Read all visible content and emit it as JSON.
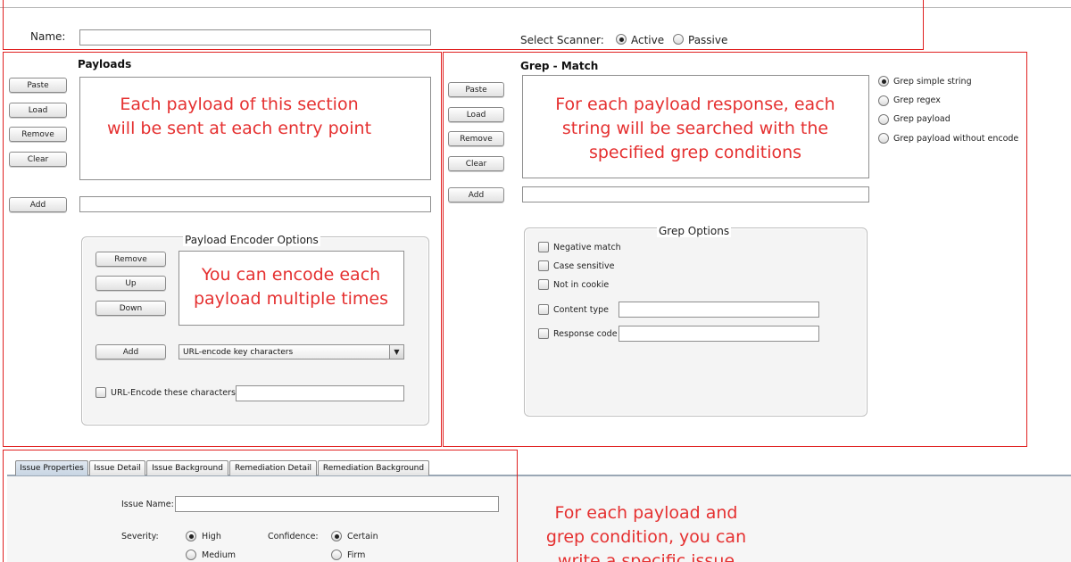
{
  "top": {
    "name_label": "Name:",
    "name_value": "",
    "scanner_label": "Select Scanner:",
    "scanner_options": [
      "Active",
      "Passive"
    ],
    "scanner_selected": "Active"
  },
  "payloads": {
    "title": "Payloads",
    "buttons": {
      "paste": "Paste",
      "load": "Load",
      "remove": "Remove",
      "clear": "Clear",
      "add": "Add"
    },
    "annotation": "Each payload of this section will be sent at each entry point",
    "add_value": ""
  },
  "encoder": {
    "title": "Payload Encoder Options",
    "buttons": {
      "remove": "Remove",
      "up": "Up",
      "down": "Down",
      "add": "Add"
    },
    "annotation": "You can encode each payload multiple times",
    "select_value": "URL-encode key characters",
    "urlencode_label": "URL-Encode these characters:",
    "urlencode_value": ""
  },
  "grep": {
    "title": "Grep - Match",
    "buttons": {
      "paste": "Paste",
      "load": "Load",
      "remove": "Remove",
      "clear": "Clear",
      "add": "Add"
    },
    "annotation": "For each payload response, each string will be searched with the specified grep conditions",
    "modes": [
      "Grep simple string",
      "Grep regex",
      "Grep payload",
      "Grep payload without encode"
    ],
    "mode_selected": "Grep simple string",
    "options_title": "Grep Options",
    "options": {
      "negative_match": "Negative match",
      "case_sensitive": "Case sensitive",
      "not_in_cookie": "Not in cookie",
      "content_type": "Content type",
      "response_code": "Response code"
    }
  },
  "issue": {
    "tabs": [
      "Issue Properties",
      "Issue Detail",
      "Issue Background",
      "Remediation Detail",
      "Remediation Background"
    ],
    "active_tab": "Issue Properties",
    "name_label": "Issue Name:",
    "severity_label": "Severity:",
    "severity_options": [
      "High",
      "Medium"
    ],
    "severity_selected": "High",
    "confidence_label": "Confidence:",
    "confidence_options": [
      "Certain",
      "Firm"
    ],
    "confidence_selected": "Certain",
    "annotation_lines": [
      "For each payload and",
      "grep condition, you can",
      "write a specific issue"
    ]
  },
  "colors": {
    "annotation_red": "#e53030",
    "frame_red": "#e02020",
    "tab_active": "#c8d5e3"
  },
  "icons": {
    "select_arrow": "dropdown-arrow-icon"
  }
}
